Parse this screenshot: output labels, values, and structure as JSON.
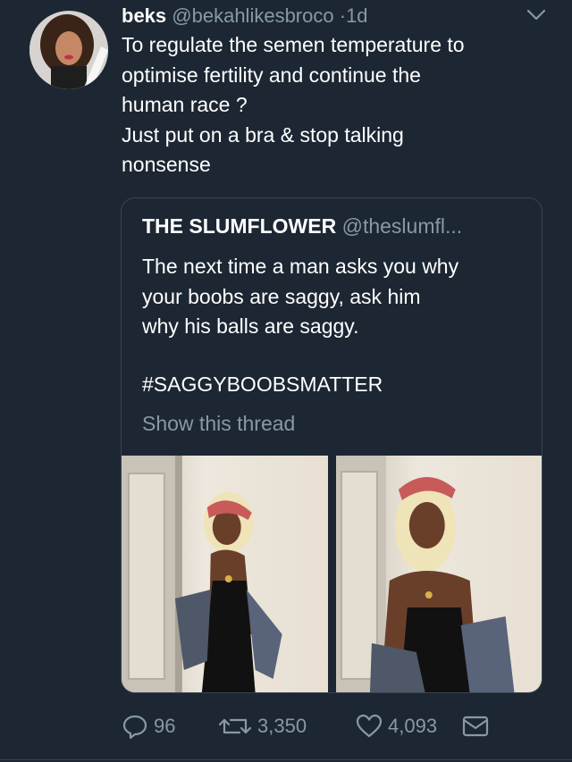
{
  "tweet": {
    "author_name": "beks",
    "author_handle": "@bekahlikesbroco",
    "separator": "·",
    "timestamp": "1d",
    "text_lines": [
      "To regulate the semen temperature to",
      "optimise fertility and continue the",
      "human race ?",
      "Just put on a bra & stop talking",
      "nonsense"
    ]
  },
  "quoted_tweet": {
    "author_name": "THE SLUMFLOWER",
    "author_handle": "@theslumfl...",
    "text_lines": [
      "The next time a man asks you why",
      "your boobs are saggy, ask him",
      "why his balls are saggy."
    ],
    "hashtag": "#SAGGYBOOBSMATTER",
    "show_thread_label": "Show this thread"
  },
  "actions": {
    "replies": "96",
    "retweets": "3,350",
    "likes": "4,093"
  },
  "icons": {
    "menu": "chevron-down-icon",
    "reply": "reply-icon",
    "retweet": "retweet-icon",
    "like": "heart-icon",
    "dm": "envelope-icon"
  },
  "colors": {
    "background": "#1c2733",
    "secondary_text": "#8899a6",
    "border": "#38444d"
  }
}
